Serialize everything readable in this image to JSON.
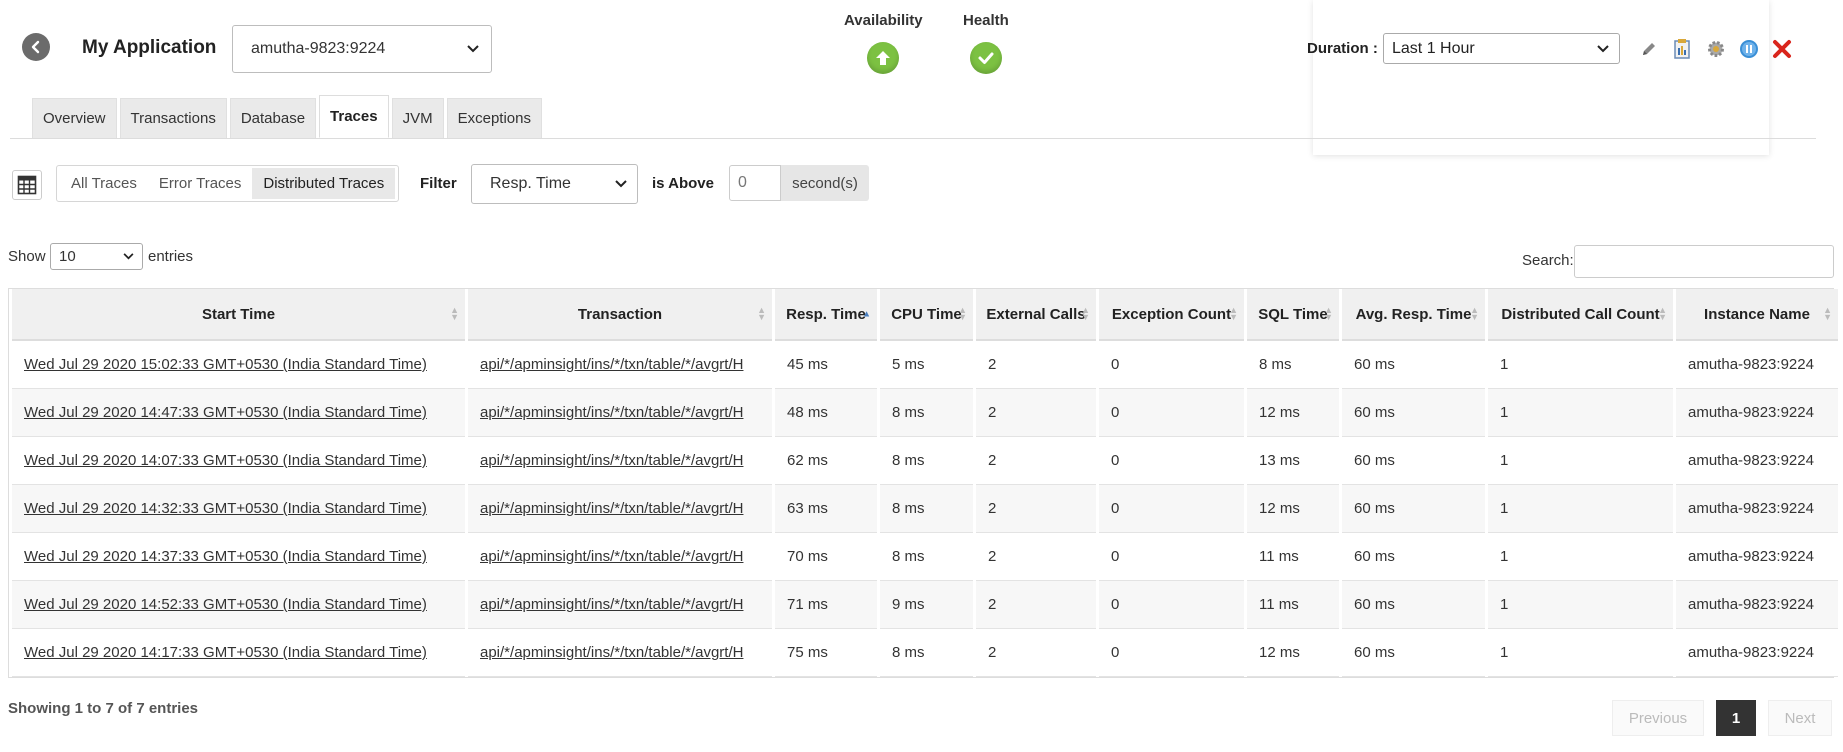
{
  "header": {
    "title": "My Application",
    "instance_selected": "amutha-9823:9224",
    "availability_label": "Availability",
    "health_label": "Health",
    "duration_label": "Duration :",
    "duration_selected": "Last 1 Hour"
  },
  "tabs": [
    {
      "label": "Overview"
    },
    {
      "label": "Transactions"
    },
    {
      "label": "Database"
    },
    {
      "label": "Traces"
    },
    {
      "label": "JVM"
    },
    {
      "label": "Exceptions"
    }
  ],
  "active_tab": "Traces",
  "filterbar": {
    "toggles": [
      "All Traces",
      "Error Traces",
      "Distributed Traces"
    ],
    "active_toggle": "Distributed Traces",
    "filter_label": "Filter",
    "filter_selected": "Resp. Time",
    "above_label": "is Above",
    "seconds_value": "0",
    "seconds_unit": "second(s)"
  },
  "listing": {
    "show_label": "Show",
    "entries_selected": "10",
    "entries_label": "entries",
    "search_label": "Search:"
  },
  "table": {
    "columns": [
      "Start Time",
      "Transaction",
      "Resp. Time",
      "CPU Time",
      "External Calls",
      "Exception Count",
      "SQL Time",
      "Avg. Resp. Time",
      "Distributed Call Count",
      "Instance Name"
    ],
    "sorted_column": "Resp. Time",
    "rows": [
      [
        "Wed Jul 29 2020 15:02:33 GMT+0530 (India Standard Time)",
        "api/*/apminsight/ins/*/txn/table/*/avgrt/H",
        "45 ms",
        "5 ms",
        "2",
        "0",
        "8 ms",
        "60 ms",
        "1",
        "amutha-9823:9224"
      ],
      [
        "Wed Jul 29 2020 14:47:33 GMT+0530 (India Standard Time)",
        "api/*/apminsight/ins/*/txn/table/*/avgrt/H",
        "48 ms",
        "8 ms",
        "2",
        "0",
        "12 ms",
        "60 ms",
        "1",
        "amutha-9823:9224"
      ],
      [
        "Wed Jul 29 2020 14:07:33 GMT+0530 (India Standard Time)",
        "api/*/apminsight/ins/*/txn/table/*/avgrt/H",
        "62 ms",
        "8 ms",
        "2",
        "0",
        "13 ms",
        "60 ms",
        "1",
        "amutha-9823:9224"
      ],
      [
        "Wed Jul 29 2020 14:32:33 GMT+0530 (India Standard Time)",
        "api/*/apminsight/ins/*/txn/table/*/avgrt/H",
        "63 ms",
        "8 ms",
        "2",
        "0",
        "12 ms",
        "60 ms",
        "1",
        "amutha-9823:9224"
      ],
      [
        "Wed Jul 29 2020 14:37:33 GMT+0530 (India Standard Time)",
        "api/*/apminsight/ins/*/txn/table/*/avgrt/H",
        "70 ms",
        "8 ms",
        "2",
        "0",
        "11 ms",
        "60 ms",
        "1",
        "amutha-9823:9224"
      ],
      [
        "Wed Jul 29 2020 14:52:33 GMT+0530 (India Standard Time)",
        "api/*/apminsight/ins/*/txn/table/*/avgrt/H",
        "71 ms",
        "9 ms",
        "2",
        "0",
        "11 ms",
        "60 ms",
        "1",
        "amutha-9823:9224"
      ],
      [
        "Wed Jul 29 2020 14:17:33 GMT+0530 (India Standard Time)",
        "api/*/apminsight/ins/*/txn/table/*/avgrt/H",
        "75 ms",
        "8 ms",
        "2",
        "0",
        "12 ms",
        "60 ms",
        "1",
        "amutha-9823:9224"
      ]
    ]
  },
  "footer": {
    "showing_text": "Showing 1 to 7 of 7 entries",
    "previous_label": "Previous",
    "current_page": "1",
    "next_label": "Next"
  },
  "colors": {
    "status_green": "#7cc142",
    "close_red": "#d9251c",
    "pause_blue": "#3a8fd6"
  },
  "icons": {
    "back": "back-arrow-icon",
    "availability": "up-arrow-icon",
    "health": "checkmark-icon",
    "edit": "pencil-icon",
    "report": "report-icon",
    "settings": "gear-icon",
    "pause": "pause-icon",
    "close": "close-icon",
    "grid": "table-grid-icon"
  }
}
